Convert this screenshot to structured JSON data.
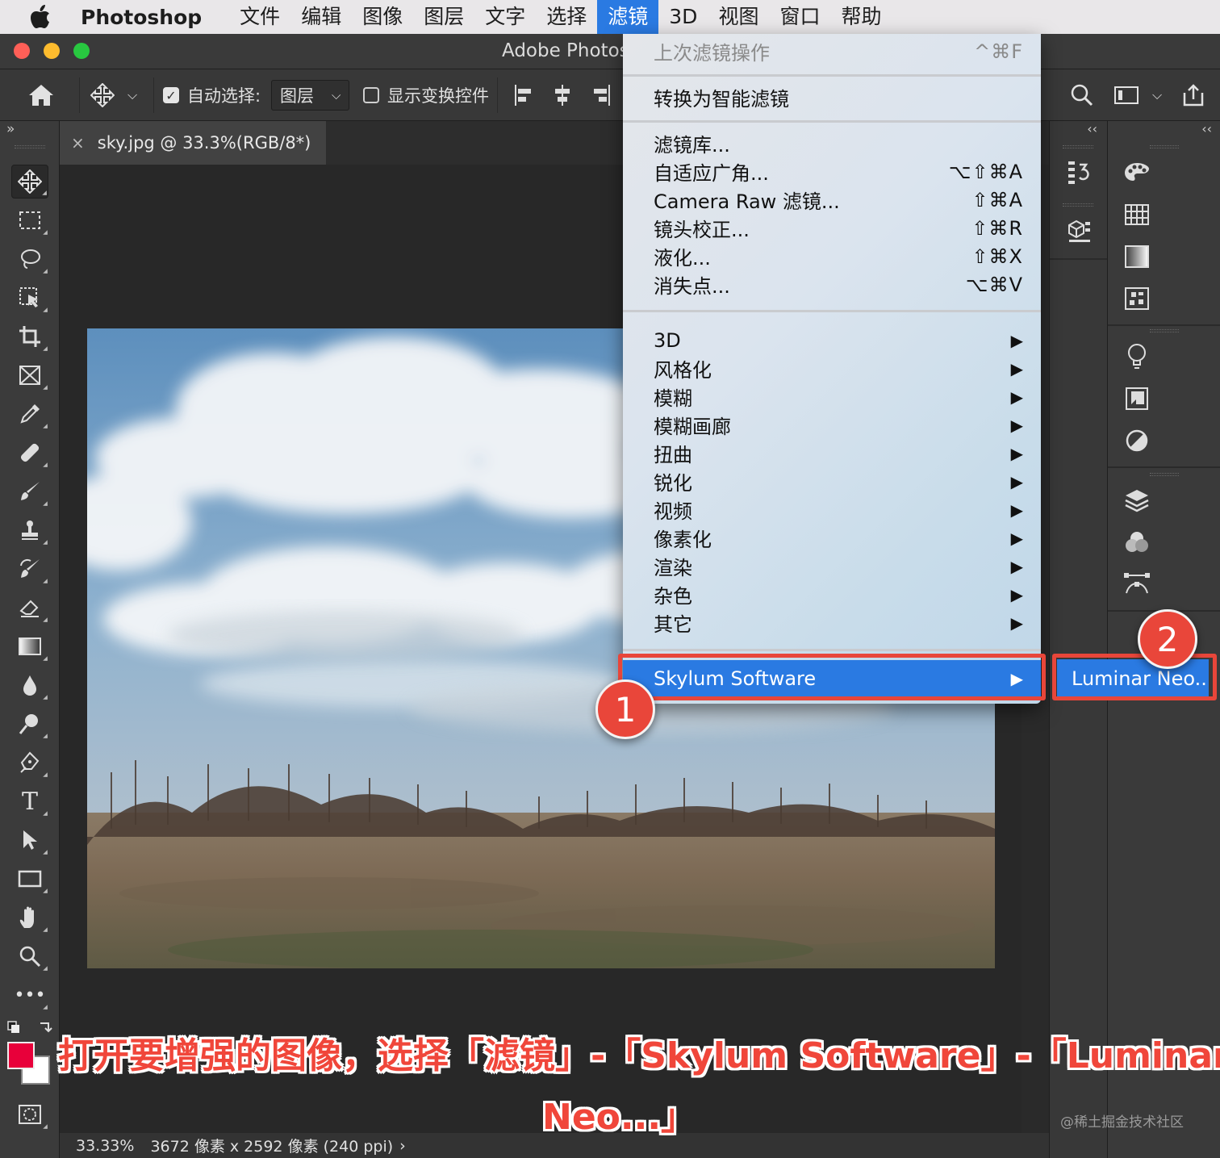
{
  "menubar": {
    "apple": "",
    "app": "Photoshop",
    "items": [
      "文件",
      "编辑",
      "图像",
      "图层",
      "文字",
      "选择",
      "滤镜",
      "3D",
      "视图",
      "窗口",
      "帮助"
    ],
    "active_index": 6
  },
  "window": {
    "title": "Adobe Photos",
    "traffic_colors": [
      "#ff5f57",
      "#febc2e",
      "#28c840"
    ]
  },
  "options": {
    "auto_select_label": "自动选择:",
    "auto_select_value": "图层",
    "show_transform_label": "显示变换控件"
  },
  "tab": {
    "close": "×",
    "title": "sky.jpg @ 33.3%(RGB/8*)"
  },
  "status": {
    "zoom": "33.33%",
    "info": "3672 像素 x 2592 像素 (240 ppi)",
    "arrow": "›"
  },
  "panel_collapse": {
    "left": "»",
    "mid": "‹‹",
    "right": "‹‹"
  },
  "filter_menu": {
    "last_filter": {
      "label": "上次滤镜操作",
      "shortcut": "^⌘F"
    },
    "smart": {
      "label": "转换为智能滤镜"
    },
    "group1": [
      {
        "label": "滤镜库...",
        "shortcut": ""
      },
      {
        "label": "自适应广角...",
        "shortcut": "⌥⇧⌘A"
      },
      {
        "label": "Camera Raw 滤镜...",
        "shortcut": "⇧⌘A"
      },
      {
        "label": "镜头校正...",
        "shortcut": "⇧⌘R"
      },
      {
        "label": "液化...",
        "shortcut": "⇧⌘X"
      },
      {
        "label": "消失点...",
        "shortcut": "⌥⌘V"
      }
    ],
    "submenus": [
      "3D",
      "风格化",
      "模糊",
      "模糊画廊",
      "扭曲",
      "锐化",
      "视频",
      "像素化",
      "渲染",
      "杂色",
      "其它"
    ],
    "submenu_arrow": "▶",
    "plugin": {
      "label": "Skylum Software",
      "arrow": "▶"
    }
  },
  "plugin_submenu": {
    "item": "Luminar Neo.."
  },
  "annotations": {
    "badge1": "1",
    "badge2": "2",
    "caption_line1": "打开要增强的图像，选择「滤镜」-「Skylum Software」-「Luminar",
    "caption_line2": "Neo...」",
    "accent": "#e8463a"
  },
  "watermark": "@稀土掘金技术社区",
  "colors": {
    "foreground": "#e8003a",
    "background": "#ffffff",
    "menu_highlight": "#2a7ae2"
  }
}
